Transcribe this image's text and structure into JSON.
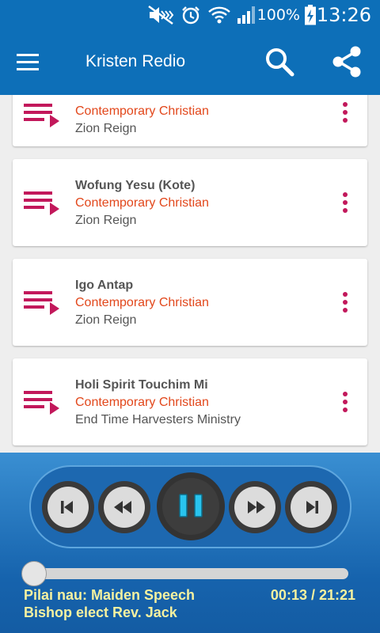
{
  "status_bar": {
    "battery_percent": "100%",
    "time": "13:26",
    "icons": [
      "mute-icon",
      "alarm-icon",
      "wifi-icon",
      "signal-icon",
      "battery-charging-icon"
    ]
  },
  "app_bar": {
    "title": "Kristen Redio",
    "icons": [
      "menu-icon",
      "search-icon",
      "share-icon"
    ]
  },
  "tracks": [
    {
      "title": "",
      "genre": "Contemporary Christian",
      "artist": "Zion Reign"
    },
    {
      "title": "Wofung Yesu (Kote)",
      "genre": "Contemporary Christian",
      "artist": "Zion Reign"
    },
    {
      "title": "Igo Antap",
      "genre": "Contemporary Christian",
      "artist": "Zion Reign"
    },
    {
      "title": "Holi Spirit Touchim Mi",
      "genre": "Contemporary Christian",
      "artist": "End Time Harvesters Ministry"
    }
  ],
  "player": {
    "now_playing_line1": "Pilai nau: Maiden Speech",
    "now_playing_line2": "Bishop elect Rev. Jack",
    "time_display": "00:13 / 21:21",
    "progress_fraction": 0.0,
    "state": "playing",
    "controls": [
      "skip-previous-icon",
      "rewind-icon",
      "pause-icon",
      "fast-forward-icon",
      "skip-next-icon"
    ]
  },
  "colors": {
    "primary": "#0d6fb8",
    "accent_icon": "#c2185b",
    "genre_text": "#e2471b",
    "now_playing_text": "#f5f1a0",
    "pause_glyph": "#29c4ee"
  }
}
